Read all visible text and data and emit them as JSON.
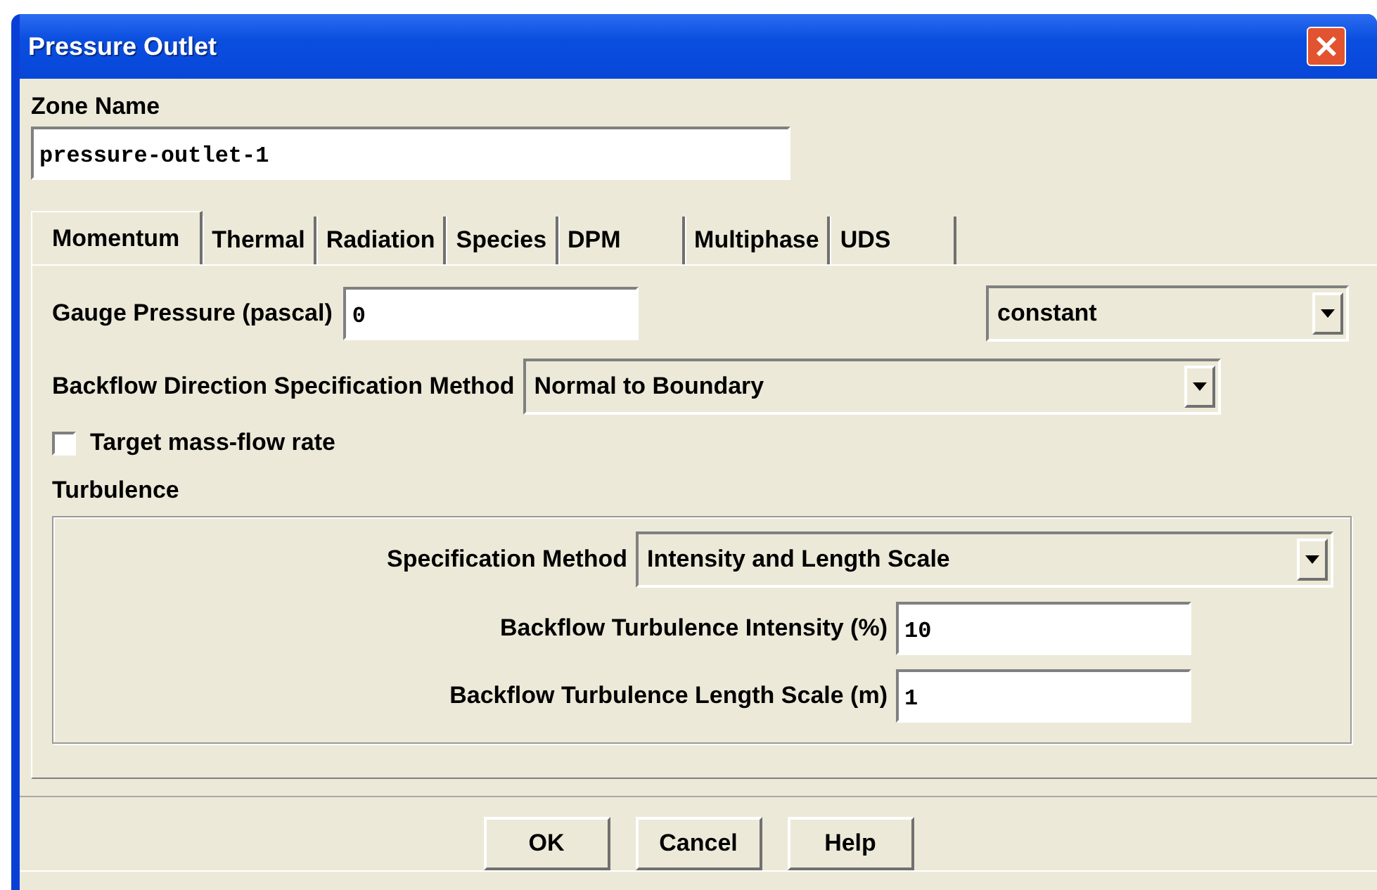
{
  "window": {
    "title": "Pressure Outlet"
  },
  "zone_name": {
    "label": "Zone Name",
    "value": "pressure-outlet-1"
  },
  "tabs": [
    {
      "label": "Momentum",
      "selected": true
    },
    {
      "label": "Thermal",
      "selected": false
    },
    {
      "label": "Radiation",
      "selected": false
    },
    {
      "label": "Species",
      "selected": false
    },
    {
      "label": "DPM",
      "selected": false
    },
    {
      "label": "Multiphase",
      "selected": false
    },
    {
      "label": "UDS",
      "selected": false
    }
  ],
  "gauge_pressure": {
    "label": "Gauge Pressure (pascal)",
    "value": "0",
    "method": "constant"
  },
  "backflow_direction": {
    "label": "Backflow Direction Specification Method",
    "value": "Normal to Boundary"
  },
  "target_mass_flow": {
    "label": "Target mass-flow rate",
    "checked": false
  },
  "turbulence": {
    "title": "Turbulence",
    "specification_method": {
      "label": "Specification Method",
      "value": "Intensity and Length Scale"
    },
    "fields": [
      {
        "label": "Backflow Turbulence Intensity (%)",
        "value": "10"
      },
      {
        "label": "Backflow Turbulence Length Scale (m)",
        "value": "1"
      }
    ]
  },
  "buttons": [
    "OK",
    "Cancel",
    "Help"
  ]
}
